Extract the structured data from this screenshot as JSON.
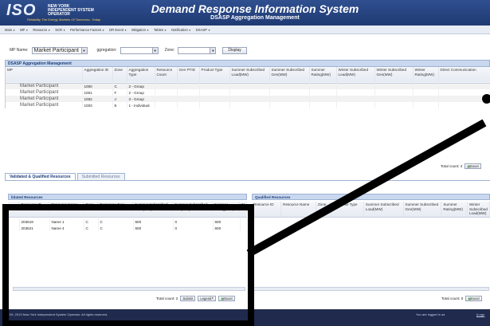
{
  "header": {
    "logo_text": "ISO",
    "logo_sub": "NEW YORK INDEPENDENT SYSTEM OPERATOR",
    "logo_tag": "Reliability The Energy Markets Of Tomorrow...Today",
    "title": "Demand Response Information System",
    "subtitle": "DSASP Aggregation Management"
  },
  "menu": [
    {
      "label": "Main"
    },
    {
      "label": "MP"
    },
    {
      "label": "Resource"
    },
    {
      "label": "SCR"
    },
    {
      "label": "Performance Factors"
    },
    {
      "label": "DR Event"
    },
    {
      "label": "Mitigation"
    },
    {
      "label": "Tables"
    },
    {
      "label": "Notification"
    },
    {
      "label": "DSASP"
    }
  ],
  "filters": {
    "mp_label": "MP Name:",
    "mp_value": "Market Participant",
    "agg_label": "ggregation:",
    "agg_value": "",
    "zone_label": "Zone:",
    "zone_value": "",
    "display_button": "Display"
  },
  "aggregation": {
    "title": "DSASP Aggregation Management",
    "columns": [
      "MP",
      "Aggregation ID",
      "Zone",
      "Aggregation Type",
      "Resource Count",
      "Gen PTID",
      "Product Type",
      "Summer Subscribed Load(MW)",
      "Summer Subscribed Gen(MW)",
      "Summer Rating(MW)",
      "Winter Subscribed Load(MW)",
      "Winter Subscribed Gen(MW)",
      "Winter Rating(MW)",
      "Direct Communication"
    ],
    "rows": [
      {
        "mp": "Market Participant",
        "id": "1000",
        "zone": "C",
        "type": "2 - Group"
      },
      {
        "mp": "Market Participant",
        "id": "1001",
        "zone": "F",
        "type": "2 - Group"
      },
      {
        "mp": "Market Participant",
        "id": "1002",
        "zone": "J",
        "type": "3 - Group"
      },
      {
        "mp": "Market Participant",
        "id": "1003",
        "zone": "E",
        "type": "1 - Individual"
      }
    ],
    "total_count": "Total count: 4",
    "excel_label": "Excel"
  },
  "tabs": [
    {
      "label": "Validated & Qualified Resources"
    },
    {
      "label": "Submitted Resources"
    }
  ],
  "validated": {
    "title": "lidated Resources",
    "columns": [
      "Resource ID",
      "Resource Name",
      "Zone",
      "Response Type",
      "Summer Subscribed Load(MW)",
      "Summer Subscribed Gen(MW)",
      "Summer Rating(MW)",
      "W"
    ],
    "rows": [
      {
        "id": "203619",
        "name": "Name 1",
        "zone": "C",
        "resp": "C",
        "ssl": "600",
        "ssg": "0",
        "sr": "600"
      },
      {
        "id": "203621",
        "name": "Name 4",
        "zone": "C",
        "resp": "C",
        "ssl": "600",
        "ssg": "0",
        "sr": "600"
      }
    ],
    "total_count": "Total count: 2",
    "submit_button": "Submit",
    "legend_button": "Legend",
    "excel_label": "Excel"
  },
  "qualified": {
    "title": "Qualified Resources",
    "columns": [
      "Resource ID",
      "Resource Name",
      "Zone",
      "Response Type",
      "Summer Subscribed Load(MW)",
      "Summer Subscribed Gen(MW)",
      "Summer Rating(MW)",
      "Winter Subscribed Load(MW)"
    ],
    "total_count": "Total count: 0",
    "excel_label": "Excel"
  },
  "footer": {
    "copyright": "09, 2013 New York Independent System Operator. All rights reserved.",
    "logged_in": "You are logged in as",
    "logout": "(Logo"
  },
  "colors": {
    "header": "#1f3a73",
    "panel": "#c9d8ee",
    "annotation": "#000000"
  }
}
